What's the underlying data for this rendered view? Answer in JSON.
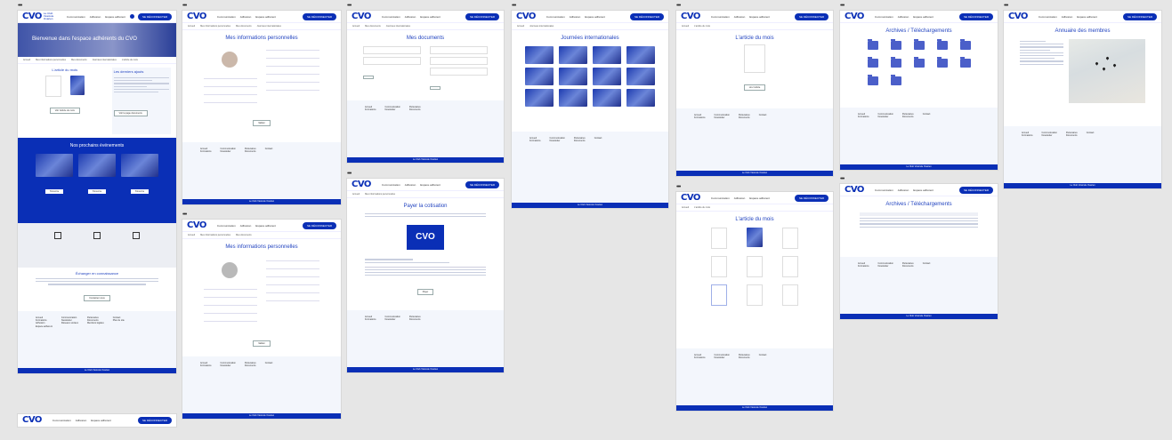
{
  "header": {
    "logo_text": "CVO",
    "logo_sub": "Le Club Vésicule Ovarien",
    "nav": [
      "Communication",
      "Adhésion",
      "Espace adhérent"
    ],
    "cta_label": "SE DÉCONNECTER"
  },
  "subnav": [
    "Accueil",
    "Mes informations personnelles",
    "Mes documents",
    "Journées internationales",
    "L'article du mois",
    "Archives / Téléchargements",
    "Annuaire des membres"
  ],
  "pages": {
    "home": {
      "hero_title": "Bienvenue dans l'espace adhérents du CVO",
      "article_heading": "L'article du mois",
      "side_heading": "Les derniers ajouts",
      "article_button": "Voir l'article du mois",
      "side_button": "Voir la page documents",
      "events_heading": "Nos prochains événements",
      "events_button": "S'inscrire",
      "exchange_heading": "Échanger en connaissance",
      "exchange_button": "Contactez-nous"
    },
    "info1": {
      "title": "Mes informations personnelles",
      "save": "Valider"
    },
    "info2": {
      "title": "Mes informations personnelles",
      "save": "Valider"
    },
    "documents": {
      "title": "Mes documents"
    },
    "payment": {
      "title": "Payer la cotisation",
      "card_brand": "CVO",
      "button": "Payer"
    },
    "journees": {
      "title": "Journées internationales"
    },
    "article1": {
      "title": "L'article du mois",
      "button": "Lire l'article"
    },
    "article2": {
      "title": "L'article du mois"
    },
    "archives1": {
      "title": "Archives / Téléchargements"
    },
    "archives2": {
      "title": "Archives / Téléchargements"
    },
    "annuaire": {
      "title": "Annuaire des membres"
    }
  },
  "footer": {
    "cols": [
      [
        "Accueil",
        "Formations",
        "Adhésion",
        "Espace adhérent"
      ],
      [
        "Communication",
        "Newsletter",
        "Réseaux sociaux"
      ],
      [
        "Partenaires",
        "Documents",
        "Mentions légales"
      ],
      [
        "Contact",
        "Plan du site"
      ]
    ],
    "bar": "Le Club Vésicule Ovarien"
  }
}
